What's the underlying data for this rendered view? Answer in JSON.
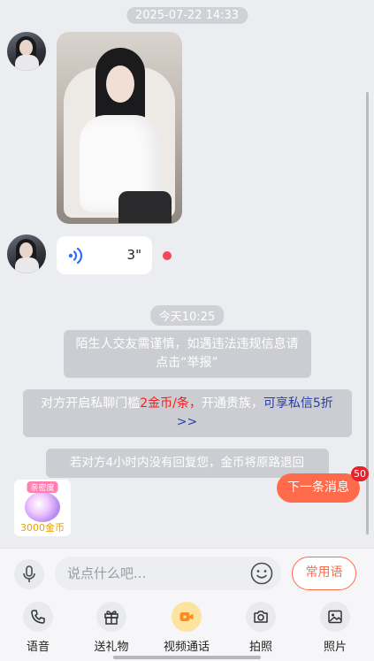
{
  "chat": {
    "timestamp_1": "2025-07-22 14:33",
    "voice_duration": "3\"",
    "timestamp_2": "今天10:25",
    "system_1": "陌生人交友需谨慎，如遇违法违规信息请点击“举报”",
    "system_2": {
      "prefix": "对方开启私聊门槛",
      "price": "2金币/条，",
      "mid": "开通贵族，",
      "link": "可享私信5折>>"
    },
    "system_3": "若对方4小时内没有回复您，金币将原路退回"
  },
  "floating": {
    "next_message_label": "下一条消息",
    "unread_count": "50",
    "gift_tag": "亲密度",
    "gift_label": "3000金币"
  },
  "input": {
    "placeholder": "说点什么吧...",
    "common_phrases_label": "常用语"
  },
  "toolbar": [
    {
      "label": "语音",
      "icon": "phone-icon"
    },
    {
      "label": "送礼物",
      "icon": "gift-icon"
    },
    {
      "label": "视频通话",
      "icon": "video-call-icon"
    },
    {
      "label": "拍照",
      "icon": "camera-icon"
    },
    {
      "label": "照片",
      "icon": "image-icon"
    }
  ],
  "colors": {
    "accent": "#ff6b4a",
    "price_red": "#f2201c",
    "link_blue": "#2b3da8",
    "unread_dot": "#f44757"
  }
}
